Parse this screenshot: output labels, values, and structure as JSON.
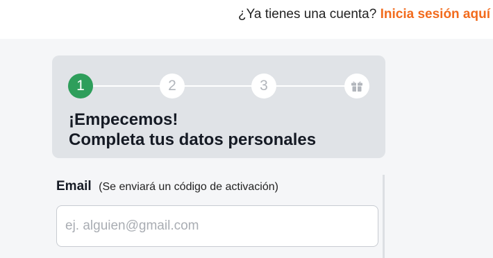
{
  "header": {
    "prompt_text": "¿Ya tienes una cuenta?",
    "login_link": "Inicia sesión aquí"
  },
  "stepper": {
    "current_step": 1,
    "steps": [
      {
        "label": "1",
        "state": "active"
      },
      {
        "label": "2",
        "state": "pending"
      },
      {
        "label": "3",
        "state": "pending"
      },
      {
        "icon": "gift-icon",
        "state": "pending"
      }
    ]
  },
  "card": {
    "title_line1": "¡Empecemos!",
    "title_line2": "Completa tus datos personales"
  },
  "form": {
    "email": {
      "label": "Email",
      "hint": "(Se enviará un código de activación)",
      "value": "",
      "placeholder": "ej. alguien@gmail.com"
    }
  },
  "colors": {
    "accent_orange": "#f26b1d",
    "step_active_green": "#2e9e5b",
    "card_background": "#e0e3e7"
  }
}
